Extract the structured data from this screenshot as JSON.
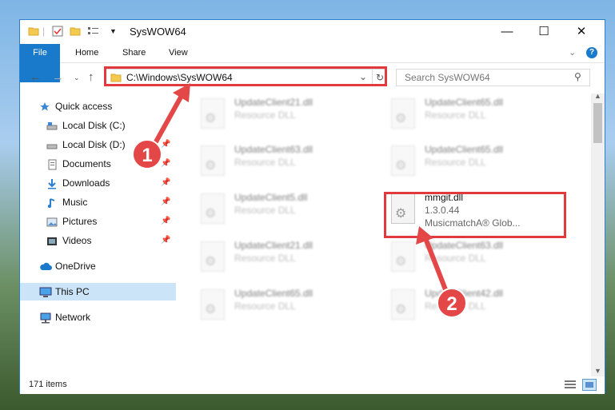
{
  "window": {
    "title": "SysWOW64"
  },
  "ribbon": {
    "tabs": [
      "File",
      "Home",
      "Share",
      "View"
    ]
  },
  "address": {
    "path": "C:\\Windows\\SysWOW64"
  },
  "search": {
    "placeholder": "Search SysWOW64"
  },
  "nav": {
    "items": [
      {
        "label": "Quick access",
        "icon": "star-icon"
      },
      {
        "label": "Local Disk (C:)",
        "icon": "drive-icon"
      },
      {
        "label": "Local Disk (D:)",
        "icon": "drive-icon"
      },
      {
        "label": "Documents",
        "icon": "documents-icon"
      },
      {
        "label": "Downloads",
        "icon": "downloads-icon"
      },
      {
        "label": "Music",
        "icon": "music-icon"
      },
      {
        "label": "Pictures",
        "icon": "pictures-icon"
      },
      {
        "label": "Videos",
        "icon": "videos-icon"
      },
      {
        "label": "OneDrive",
        "icon": "cloud-icon"
      },
      {
        "label": "This PC",
        "icon": "computer-icon"
      },
      {
        "label": "Network",
        "icon": "network-icon"
      }
    ]
  },
  "files": {
    "left": [
      {
        "name": "UpdateClient21.dll",
        "type": "Resource DLL"
      },
      {
        "name": "UpdateClient63.dll",
        "type": "Resource DLL"
      },
      {
        "name": "UpdateClient5.dll",
        "type": "Resource DLL"
      },
      {
        "name": "UpdateClient21.dll",
        "type": "Resource DLL"
      },
      {
        "name": "UpdateClient65.dll",
        "type": "Resource DLL"
      }
    ],
    "right": [
      {
        "name": "UpdateClient65.dll",
        "type": "Resource DLL"
      },
      {
        "name": "UpdateClient65.dll",
        "type": "Resource DLL"
      },
      {
        "name": "UpdateClient63.dll",
        "type": "Resource DLL"
      },
      {
        "name": "UpdateClient42.dll",
        "type": "Resource DLL"
      }
    ],
    "highlighted": {
      "name": "mmgit.dll",
      "version": "1.3.0.44",
      "company": "MusicmatchA® Glob..."
    }
  },
  "status": {
    "count": "171 items"
  },
  "annotations": {
    "step1": "1",
    "step2": "2"
  },
  "colors": {
    "accent": "#1979ca",
    "highlight": "#e0393e",
    "selection": "#cce4f7"
  }
}
